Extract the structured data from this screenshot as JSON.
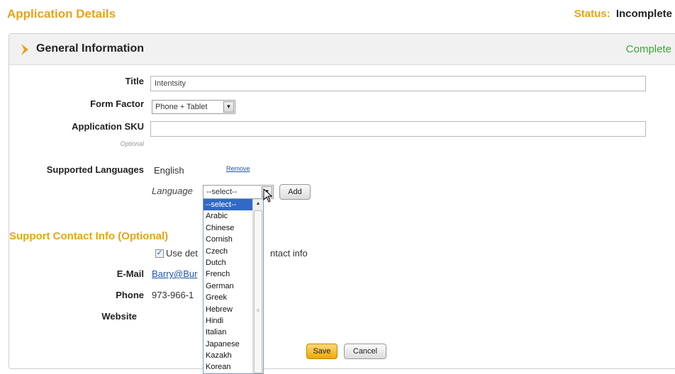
{
  "page": {
    "title": "Application Details",
    "status_label": "Status:",
    "status_value": "Incomplete"
  },
  "section": {
    "title": "General Information",
    "status": "Complete"
  },
  "form": {
    "title_label": "Title",
    "title_value": "Intentsity",
    "form_factor_label": "Form Factor",
    "form_factor_value": "Phone + Tablet",
    "sku_label": "Application SKU",
    "sku_value": "",
    "sku_note": "Optional",
    "languages_label": "Supported Languages",
    "language_current": "English",
    "remove_link": "Remove",
    "language_field_label": "Language",
    "language_select_value": "--select--",
    "add_button": "Add"
  },
  "language_options": [
    "--select--",
    "Arabic",
    "Chinese",
    "Cornish",
    "Czech",
    "Dutch",
    "French",
    "German",
    "Greek",
    "Hebrew",
    "Hindi",
    "Italian",
    "Japanese",
    "Kazakh",
    "Korean"
  ],
  "support": {
    "title": "Support Contact Info (Optional)",
    "checkbox_label_start": "Use det",
    "checkbox_label_end": "ntact info",
    "email_label": "E-Mail",
    "email_value": "Barry@Bur",
    "phone_label": "Phone",
    "phone_value": "973-966-1",
    "website_label": "Website"
  },
  "actions": {
    "save": "Save",
    "cancel": "Cancel"
  },
  "colors": {
    "accent": "#e8a317",
    "complete": "#3aa83a",
    "link": "#2255aa"
  },
  "icons": {
    "chevron": "chevron-right-icon",
    "dropdown": "chevron-down-icon",
    "checkbox": "check-icon"
  }
}
